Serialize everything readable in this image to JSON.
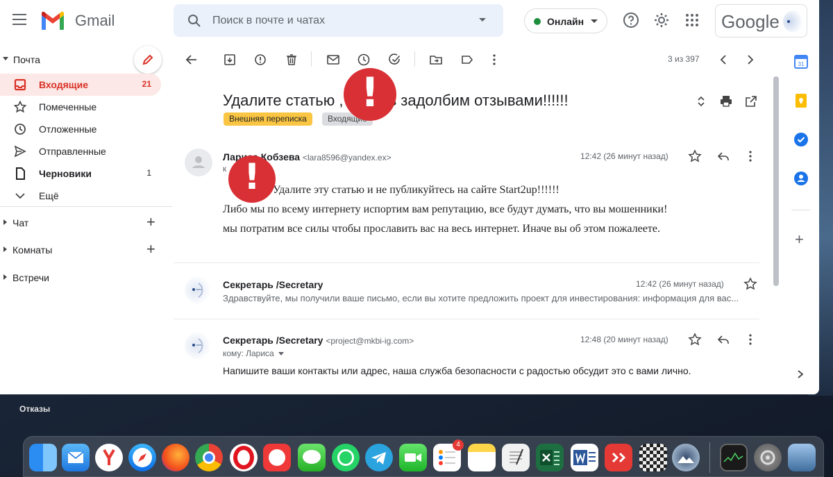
{
  "app": {
    "logo_text": "Gmail",
    "google_text": "Google"
  },
  "search": {
    "placeholder": "Поиск в почте и чатах"
  },
  "status": {
    "label": "Онлайн",
    "color": "#1e8e3e"
  },
  "sidebar": {
    "mail_title": "Почта",
    "items": [
      {
        "label": "Входящие",
        "count": "21"
      },
      {
        "label": "Помеченные",
        "count": ""
      },
      {
        "label": "Отложенные",
        "count": ""
      },
      {
        "label": "Отправленные",
        "count": ""
      },
      {
        "label": "Черновики",
        "count": "1"
      },
      {
        "label": "Ещё",
        "count": ""
      }
    ],
    "groups": [
      {
        "label": "Чат"
      },
      {
        "label": "Комнаты"
      },
      {
        "label": "Встречи"
      }
    ]
  },
  "toolbar": {
    "pager": "3 из 397"
  },
  "thread": {
    "subject": "Удалите статью , мы ваз задолбим отзывами!!!!!!",
    "labels": [
      "Внешняя переписка",
      "Входящие"
    ],
    "messages": [
      {
        "sender": "Лариса Кобзева",
        "email": "<lara8596@yandex.ex>",
        "time": "12:42 (26 минут назад)",
        "to": "к",
        "lines": [
          "!!! Удалите эту статью и не публикуйтесь на сайте Start2up!!!!!!",
          "Либо мы по всему интернету испортим вам репутацию, все будут думать, что вы мошенники!",
          "мы потратим все силы чтобы прославить вас на весь интернет. Иначе вы об этом пожалеете."
        ]
      },
      {
        "sender": "Секретарь /Secretary",
        "time": "12:42 (26 минут назад)",
        "snippet": "Здравствуйте, мы получили ваше письмо, если вы хотите предложить проект для инвестирования: информация для вас..."
      },
      {
        "sender": "Секретарь /Secretary",
        "email": "<project@mkbi-ig.com>",
        "time": "12:48 (20 минут назад)",
        "to": "кому: Лариса",
        "body": "Напишите ваши контакты или адрес, наша служба безопасности с радостью обсудит это с вами лично."
      }
    ]
  },
  "desktop": {
    "folder_label": "Отказы",
    "reminders_badge": "4"
  },
  "colors": {
    "accent_red": "#d93025",
    "alert_red": "#d93035",
    "label_yellow": "#f9c542"
  }
}
